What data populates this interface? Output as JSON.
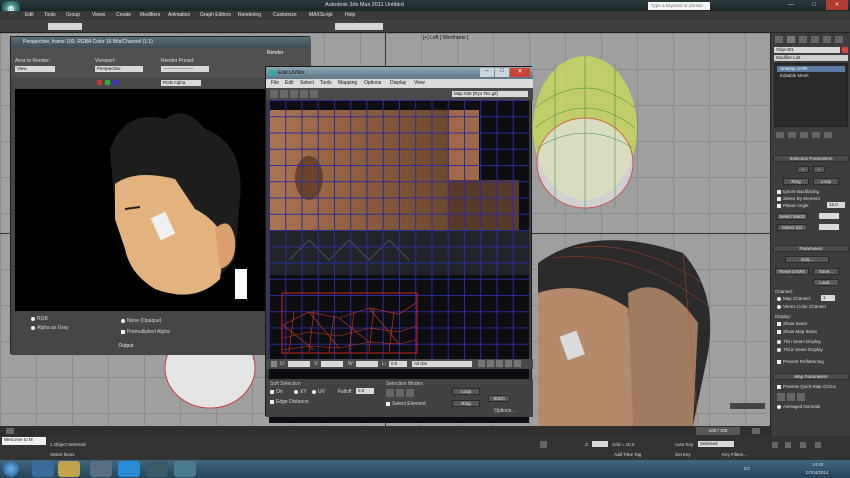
{
  "window": {
    "app_icon": "3ds-max-logo",
    "title": "Autodesk 3ds Max 2011        Untitled",
    "search_placeholder": "Type a keyword or phrase",
    "min": "—",
    "max": "□",
    "close": "✕"
  },
  "menubar": [
    "Edit",
    "Tools",
    "Group",
    "Views",
    "Create",
    "Modifiers",
    "Animation",
    "Graph Editors",
    "Rendering",
    "Customize",
    "MAXScript",
    "Help"
  ],
  "render_window": {
    "title": "Perspective, frame 100, RGBA Color 16 Bits/Channel (1:1)",
    "render_button": "Render",
    "area_label": "Area to Render:",
    "area_value": "View",
    "viewport_label": "Viewport:",
    "viewport_value": "Perspective",
    "preset_label": "Render Preset:",
    "preset_value": "--------------------",
    "channel_value": "RGB Alpha",
    "rgb_label": "RGB",
    "alpha_gray_label": "Alpha as Gray",
    "none_opaque_label": "None (Opaque)",
    "premultiplied_label": "Premultiplied Alpha",
    "output_label": "Output"
  },
  "uvw_editor": {
    "title": "Edit UVWs",
    "menu": [
      "File",
      "Edit",
      "Select",
      "Tools",
      "Mapping",
      "Options",
      "Display",
      "View"
    ],
    "map_dropdown": "Map #26 (Ryo Tex.gif)",
    "u_label": "U:",
    "u_value": "",
    "v_label": "V:",
    "v_value": "",
    "w_label": "W:",
    "w_value": "",
    "l_label": "L:",
    "l_value": "0.0",
    "ids_dropdown": "All IDs",
    "soft_selection_label": "Soft Selection",
    "on_label": "On",
    "xy_label": "XY",
    "uv_label": "UV",
    "edge_distance_label": "Edge Distance",
    "falloff_label": "Falloff:",
    "falloff_value": "0.0",
    "selection_modes_label": "Selection Modes",
    "select_element_label": "Select Element",
    "loop_label": "Loop",
    "ring_label": "Ring",
    "stitch_label": "Stitch",
    "options_label": "Options..."
  },
  "viewports": {
    "top_right_label": "[+] Left [ Wireframe ]"
  },
  "command_panel": {
    "object_name": "Object01",
    "modifier_list": "Modifier List",
    "stack": [
      "Unwrap UVW",
      "Editable Mesh"
    ],
    "selection_params": "Selection Parameters",
    "ring_btn": "Ring",
    "loop_btn": "Loop",
    "ignore_backfacing": "Ignore Backfacing",
    "select_by_element": "Select By Element",
    "planar_angle": "Planar Angle",
    "planar_value": "15.0",
    "select_matid": "Select MatID",
    "select_sg": "Select SG",
    "parameters": "Parameters",
    "edit_btn": "Edit...",
    "reset_uvws": "Reset UVWs",
    "save_btn": "Save...",
    "load_btn": "Load...",
    "channel_label": "Channel:",
    "map_channel": "Map Channel:",
    "map_channel_value": "1",
    "vertex_color_channel": "Vertex Color Channel",
    "display_label": "Display:",
    "show_seam": "Show Seam",
    "show_map_seam": "Show Map Seam",
    "thin_seam_display": "Thin Seam Display",
    "thick_seam_display": "Thick Seam Display",
    "prevent_reflattening": "Prevent Reflattening",
    "map_parameters": "Map Parameters",
    "preview_quick_map": "Preview Quick Map Gizmo",
    "averaged_normals": "Averaged Normals"
  },
  "timeline": {
    "frame_counter": "100 / 100"
  },
  "status": {
    "selection": "1 Object Selected",
    "prompt": "Select faces",
    "maxscript": "Welcome to M",
    "z_label": "Z:",
    "grid": "Grid = 10.0",
    "auto_key": "Auto Key",
    "selected": "Selected",
    "set_key": "Set Key",
    "key_filters": "Key Filters...",
    "add_time_tag": "Add Time Tag"
  },
  "taskbar": {
    "lang": "ES",
    "time": "14:20",
    "date": "07/04/2014"
  }
}
